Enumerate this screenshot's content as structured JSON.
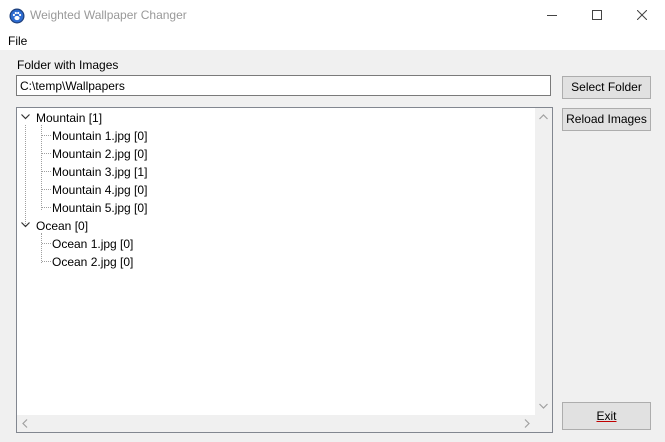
{
  "window": {
    "title": "Weighted Wallpaper Changer",
    "icon": "app-paw-icon"
  },
  "menu": {
    "file_label": "File"
  },
  "folder": {
    "label": "Folder with Images",
    "path": "C:\\temp\\Wallpapers"
  },
  "buttons": {
    "select_folder": "Select Folder",
    "reload_images": "Reload Images",
    "exit": "Exit"
  },
  "tree": {
    "groups": [
      {
        "label": "Mountain [1]",
        "expanded": true,
        "items": [
          "Mountain 1.jpg [0]",
          "Mountain 2.jpg [0]",
          "Mountain 3.jpg [1]",
          "Mountain 4.jpg [0]",
          "Mountain 5.jpg [0]"
        ]
      },
      {
        "label": "Ocean [0]",
        "expanded": true,
        "items": [
          "Ocean 1.jpg [0]",
          "Ocean 2.jpg [0]"
        ]
      }
    ]
  },
  "colors": {
    "exit_accent": "#c00000"
  }
}
